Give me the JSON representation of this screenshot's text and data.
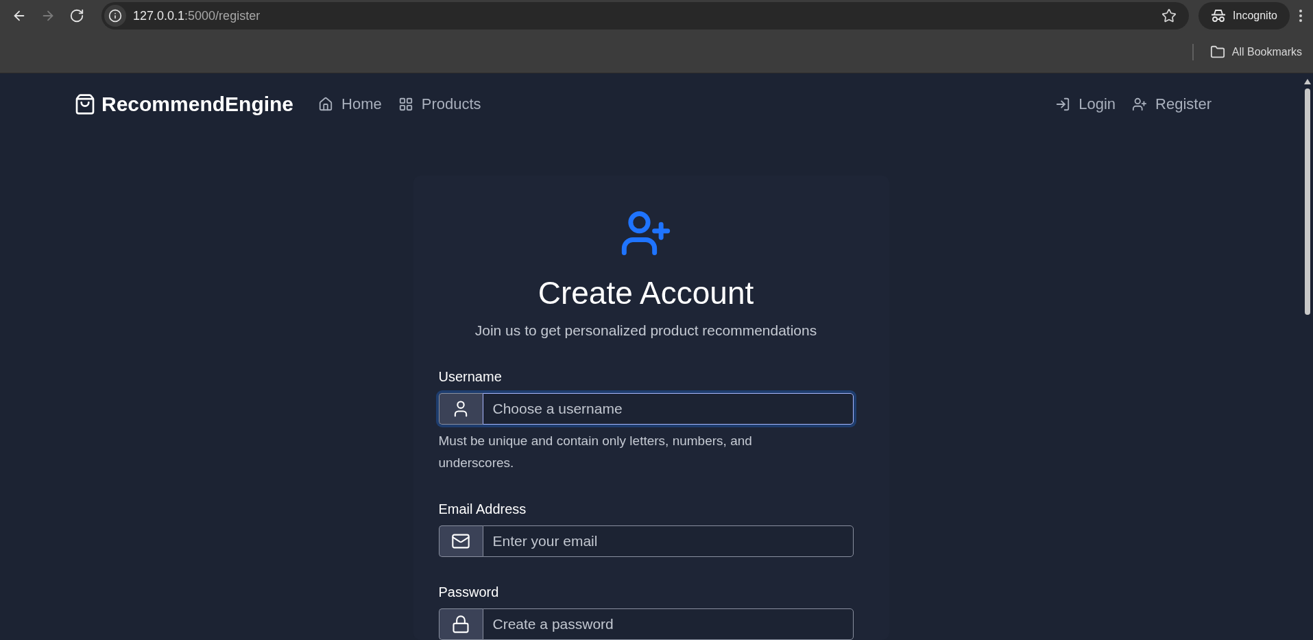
{
  "browser": {
    "nav_buttons": [
      {
        "kind": "back",
        "disabled": false
      },
      {
        "kind": "forward",
        "disabled": true
      },
      {
        "kind": "reload",
        "disabled": false
      }
    ],
    "url_host": "127.0.0.1",
    "url_path": ":5000/register",
    "profile": "Incognito",
    "bookmarks": [
      {
        "label": "All Bookmarks"
      }
    ]
  },
  "navbar": {
    "brand": "RecommendEngine",
    "links": [
      {
        "kind": "home",
        "label": "Home"
      },
      {
        "kind": "products",
        "label": "Products"
      }
    ],
    "auth_links": [
      {
        "kind": "login",
        "label": "Login"
      },
      {
        "kind": "register",
        "label": "Register"
      }
    ]
  },
  "form": {
    "title": "Create Account",
    "subtitle": "Join us to get personalized product recommendations",
    "fields": [
      {
        "kind": "user",
        "label": "Username",
        "placeholder": "Choose a username",
        "focused": true,
        "help": "Must be unique and contain only letters, numbers, and underscores."
      },
      {
        "kind": "mail",
        "label": "Email Address",
        "placeholder": "Enter your email",
        "focused": false
      },
      {
        "kind": "lock",
        "label": "Password",
        "placeholder": "Create a password",
        "focused": false
      }
    ]
  }
}
